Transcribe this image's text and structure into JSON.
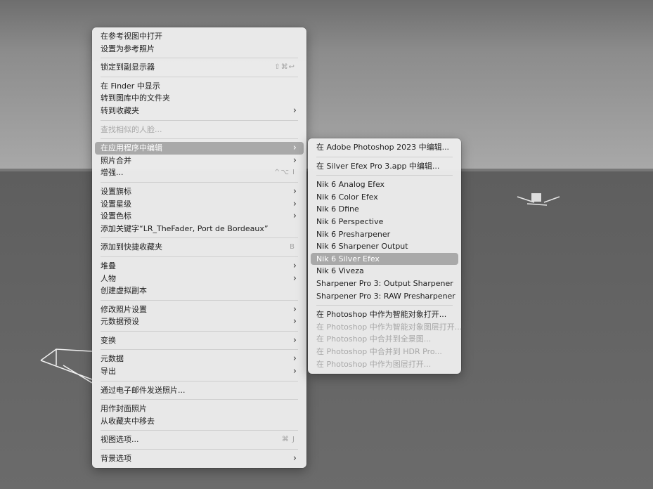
{
  "main_menu": {
    "groups": [
      [
        {
          "label": "在参考视图中打开"
        },
        {
          "label": "设置为参考照片"
        }
      ],
      [
        {
          "label": "锁定到副显示器",
          "shortcut": "⇧⌘↩"
        }
      ],
      [
        {
          "label": "在 Finder 中显示"
        },
        {
          "label": "转到图库中的文件夹"
        },
        {
          "label": "转到收藏夹",
          "submenu": true
        }
      ],
      [
        {
          "label": "查找相似的人脸...",
          "disabled": true
        }
      ],
      [
        {
          "label": "在应用程序中编辑",
          "submenu": true,
          "selected": true
        },
        {
          "label": "照片合并",
          "submenu": true
        },
        {
          "label": "增强...",
          "shortcut": "^⌥ I"
        }
      ],
      [
        {
          "label": "设置旗标",
          "submenu": true
        },
        {
          "label": "设置星级",
          "submenu": true
        },
        {
          "label": "设置色标",
          "submenu": true
        },
        {
          "label": "添加关键字“LR_TheFader, Port de Bordeaux”"
        }
      ],
      [
        {
          "label": "添加到快捷收藏夹",
          "shortcut": "B"
        }
      ],
      [
        {
          "label": "堆叠",
          "submenu": true
        },
        {
          "label": "人物",
          "submenu": true
        },
        {
          "label": "创建虚拟副本"
        }
      ],
      [
        {
          "label": "修改照片设置",
          "submenu": true
        },
        {
          "label": "元数据预设",
          "submenu": true
        }
      ],
      [
        {
          "label": "变换",
          "submenu": true
        }
      ],
      [
        {
          "label": "元数据",
          "submenu": true
        },
        {
          "label": "导出",
          "submenu": true
        }
      ],
      [
        {
          "label": "通过电子邮件发送照片..."
        }
      ],
      [
        {
          "label": "用作封面照片"
        },
        {
          "label": "从收藏夹中移去"
        }
      ],
      [
        {
          "label": "视图选项...",
          "shortcut": "⌘ J"
        }
      ],
      [
        {
          "label": "背景选项",
          "submenu": true
        }
      ]
    ]
  },
  "sub_menu": {
    "groups": [
      [
        {
          "label": "在 Adobe Photoshop 2023 中编辑..."
        }
      ],
      [
        {
          "label": "在 Silver Efex Pro 3.app 中编辑..."
        }
      ],
      [
        {
          "label": "Nik 6 Analog Efex"
        },
        {
          "label": "Nik 6 Color Efex"
        },
        {
          "label": "Nik 6 Dfine"
        },
        {
          "label": "Nik 6 Perspective"
        },
        {
          "label": "Nik 6 Presharpener"
        },
        {
          "label": "Nik 6 Sharpener Output"
        },
        {
          "label": "Nik 6 Silver Efex",
          "selected": true
        },
        {
          "label": "Nik 6 Viveza"
        },
        {
          "label": "Sharpener Pro 3: Output Sharpener"
        },
        {
          "label": "Sharpener Pro 3: RAW Presharpener"
        }
      ],
      [
        {
          "label": "在 Photoshop 中作为智能对象打开..."
        },
        {
          "label": "在 Photoshop 中作为智能对象图层打开...",
          "disabled": true
        },
        {
          "label": "在 Photoshop 中合并到全景图...",
          "disabled": true
        },
        {
          "label": "在 Photoshop 中合并到 HDR Pro...",
          "disabled": true
        },
        {
          "label": "在 Photoshop 中作为图层打开...",
          "disabled": true
        }
      ]
    ]
  },
  "colors": {
    "menu_bg": "#ececec",
    "highlight": "#a9a9a9",
    "disabled_text": "#a8a8a8"
  },
  "icons": {
    "submenu_arrow": "chevron-right-icon"
  }
}
